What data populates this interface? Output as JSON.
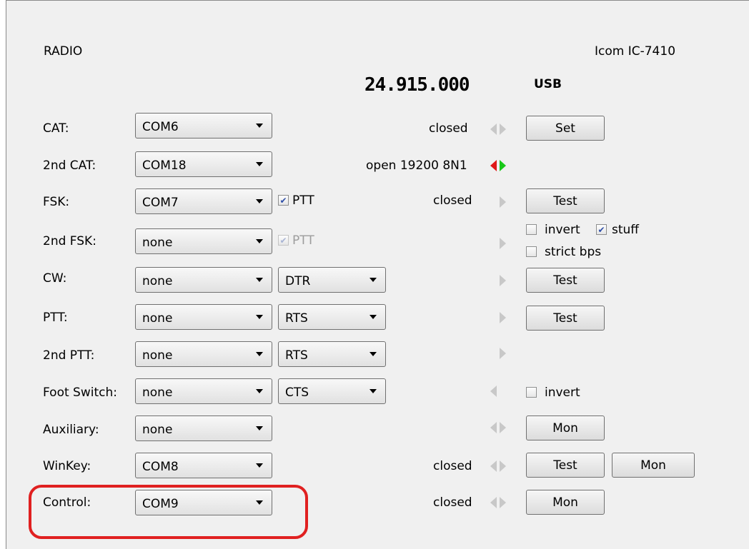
{
  "header": {
    "section_title": "RADIO",
    "radio_model": "Icom IC-7410"
  },
  "display": {
    "frequency": "24.915.000",
    "mode": "USB"
  },
  "rows": {
    "cat": {
      "label": "CAT:",
      "port": "COM6",
      "status": "closed",
      "button": "Set"
    },
    "cat2": {
      "label": "2nd CAT:",
      "port": "COM18",
      "status": "open 19200 8N1"
    },
    "fsk": {
      "label": "FSK:",
      "port": "COM7",
      "ptt_label": "PTT",
      "status": "closed",
      "button": "Test"
    },
    "fsk2": {
      "label": "2nd FSK:",
      "port": "none",
      "ptt_label": "PTT",
      "invert_label": "invert",
      "stuff_label": "stuff",
      "strict_label": "strict bps"
    },
    "cw": {
      "label": "CW:",
      "port": "none",
      "line": "DTR",
      "button": "Test"
    },
    "ptt": {
      "label": "PTT:",
      "port": "none",
      "line": "RTS",
      "button": "Test"
    },
    "ptt2": {
      "label": "2nd PTT:",
      "port": "none",
      "line": "RTS"
    },
    "foot": {
      "label": "Foot Switch:",
      "port": "none",
      "line": "CTS",
      "invert_label": "invert"
    },
    "aux": {
      "label": "Auxiliary:",
      "port": "none",
      "button": "Mon"
    },
    "winkey": {
      "label": "WinKey:",
      "port": "COM8",
      "status": "closed",
      "button_test": "Test",
      "button_mon": "Mon"
    },
    "control": {
      "label": "Control:",
      "port": "COM9",
      "status": "closed",
      "button": "Mon"
    }
  },
  "colors": {
    "highlight": "#e02020",
    "rx_active": "#e01818",
    "tx_active": "#18c818"
  }
}
